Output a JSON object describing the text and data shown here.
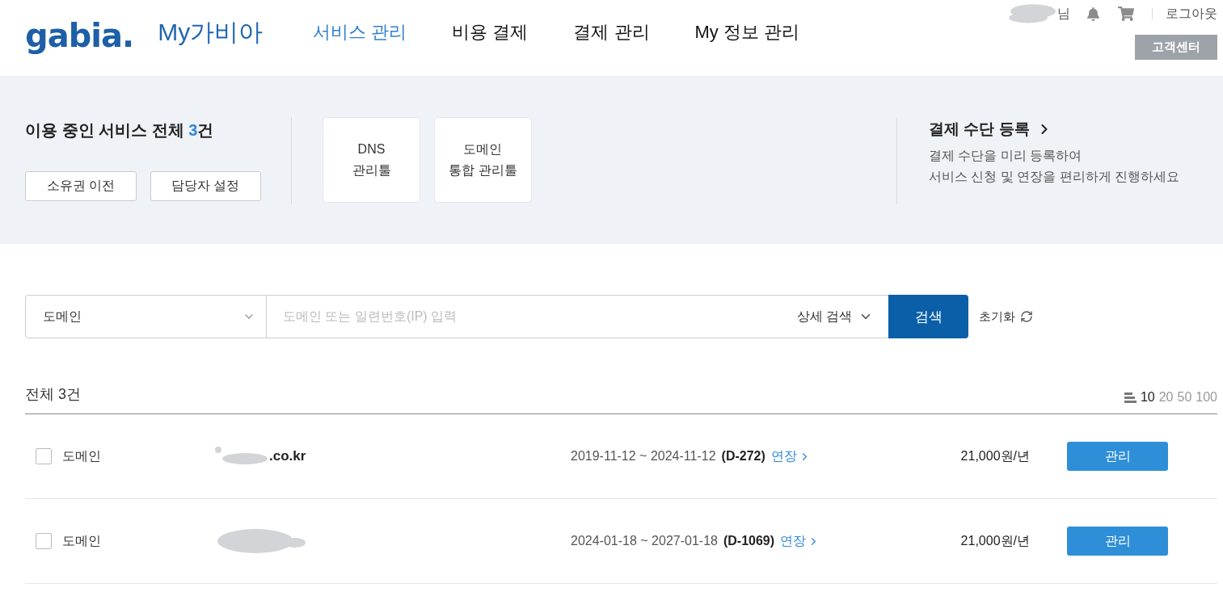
{
  "header": {
    "logo": "gabia.",
    "app_name": "My가비아",
    "nav": [
      {
        "label": "서비스 관리",
        "selected": true
      },
      {
        "label": "비용 결제",
        "selected": false
      },
      {
        "label": "결제 관리",
        "selected": false
      },
      {
        "label": "My 정보 관리",
        "selected": false
      }
    ],
    "user": {
      "name_redacted": true,
      "honorific": "님"
    },
    "logout": "로그아웃",
    "support_button": "고객센터"
  },
  "summary_panel": {
    "title_prefix": "이용 중인 서비스 전체 ",
    "count": "3",
    "title_suffix": "건",
    "actions": [
      "소유권 이전",
      "담당자 설정"
    ],
    "tools": [
      {
        "label": "DNS\n관리툴"
      },
      {
        "label": "도메인\n통합 관리툴"
      }
    ],
    "payment_promo": {
      "title": "결제 수단 등록",
      "description": "결제 수단을 미리 등록하여\n서비스 신청 및 연장을 편리하게 진행하세요"
    }
  },
  "search": {
    "category": "도메인",
    "placeholder": "도메인 또는 일련번호(IP) 입력",
    "advanced": "상세 검색",
    "button": "검색",
    "reset": "초기화"
  },
  "list": {
    "total": "전체 3건",
    "page_sizes": [
      {
        "label": "10",
        "selected": true
      },
      {
        "label": "20",
        "selected": false
      },
      {
        "label": "50",
        "selected": false
      },
      {
        "label": "100",
        "selected": false
      }
    ],
    "rows": [
      {
        "checked": false,
        "type": "도메인",
        "domain": {
          "redacted": true,
          "text": ".co.kr"
        },
        "period": "2019-11-12 ~ 2024-11-12",
        "d_day": "(D-272)",
        "renew": "연장",
        "price": "21,000원/년",
        "action": "관리"
      },
      {
        "checked": false,
        "type": "도메인",
        "domain": {
          "redacted": true
        },
        "period": "2024-01-18 ~ 2027-01-18",
        "d_day": "(D-1069)",
        "renew": "연장",
        "price": "21,000원/년",
        "action": "관리"
      }
    ]
  }
}
